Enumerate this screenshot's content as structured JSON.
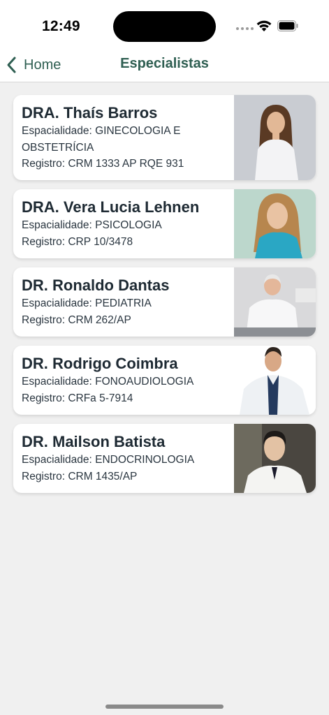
{
  "status": {
    "time": "12:49"
  },
  "nav": {
    "back_label": "Home",
    "title": "Especialistas"
  },
  "specialists": [
    {
      "name": "DRA. Thaís Barros",
      "specialty": "Espacialidade: GINECOLOGIA E OBSTETRÍCIA",
      "registry": "Registro: CRM 1333 AP RQE 931",
      "photo_bg": "#c9ccd2"
    },
    {
      "name": "DRA. Vera Lucia Lehnen",
      "specialty": "Espacialidade: PSICOLOGIA",
      "registry": "Registro: CRP 10/3478",
      "photo_bg": "#bcd7cc"
    },
    {
      "name": "DR. Ronaldo Dantas",
      "specialty": "Espacialidade: PEDIATRIA",
      "registry": "Registro: CRM 262/AP",
      "photo_bg": "#d9d9db"
    },
    {
      "name": "DR. Rodrigo Coimbra",
      "specialty": "Espacialidade: FONOAUDIOLOGIA",
      "registry": "Registro: CRFa 5-7914",
      "photo_bg": "#ffffff"
    },
    {
      "name": "DR. Mailson Batista",
      "specialty": "Espacialidade: ENDOCRINOLOGIA",
      "registry": "Registro: CRM 1435/AP",
      "photo_bg": "#4a4640"
    }
  ],
  "colors": {
    "accent": "#2f5f52",
    "text": "#1e2a33",
    "background": "#f0f0f0"
  }
}
